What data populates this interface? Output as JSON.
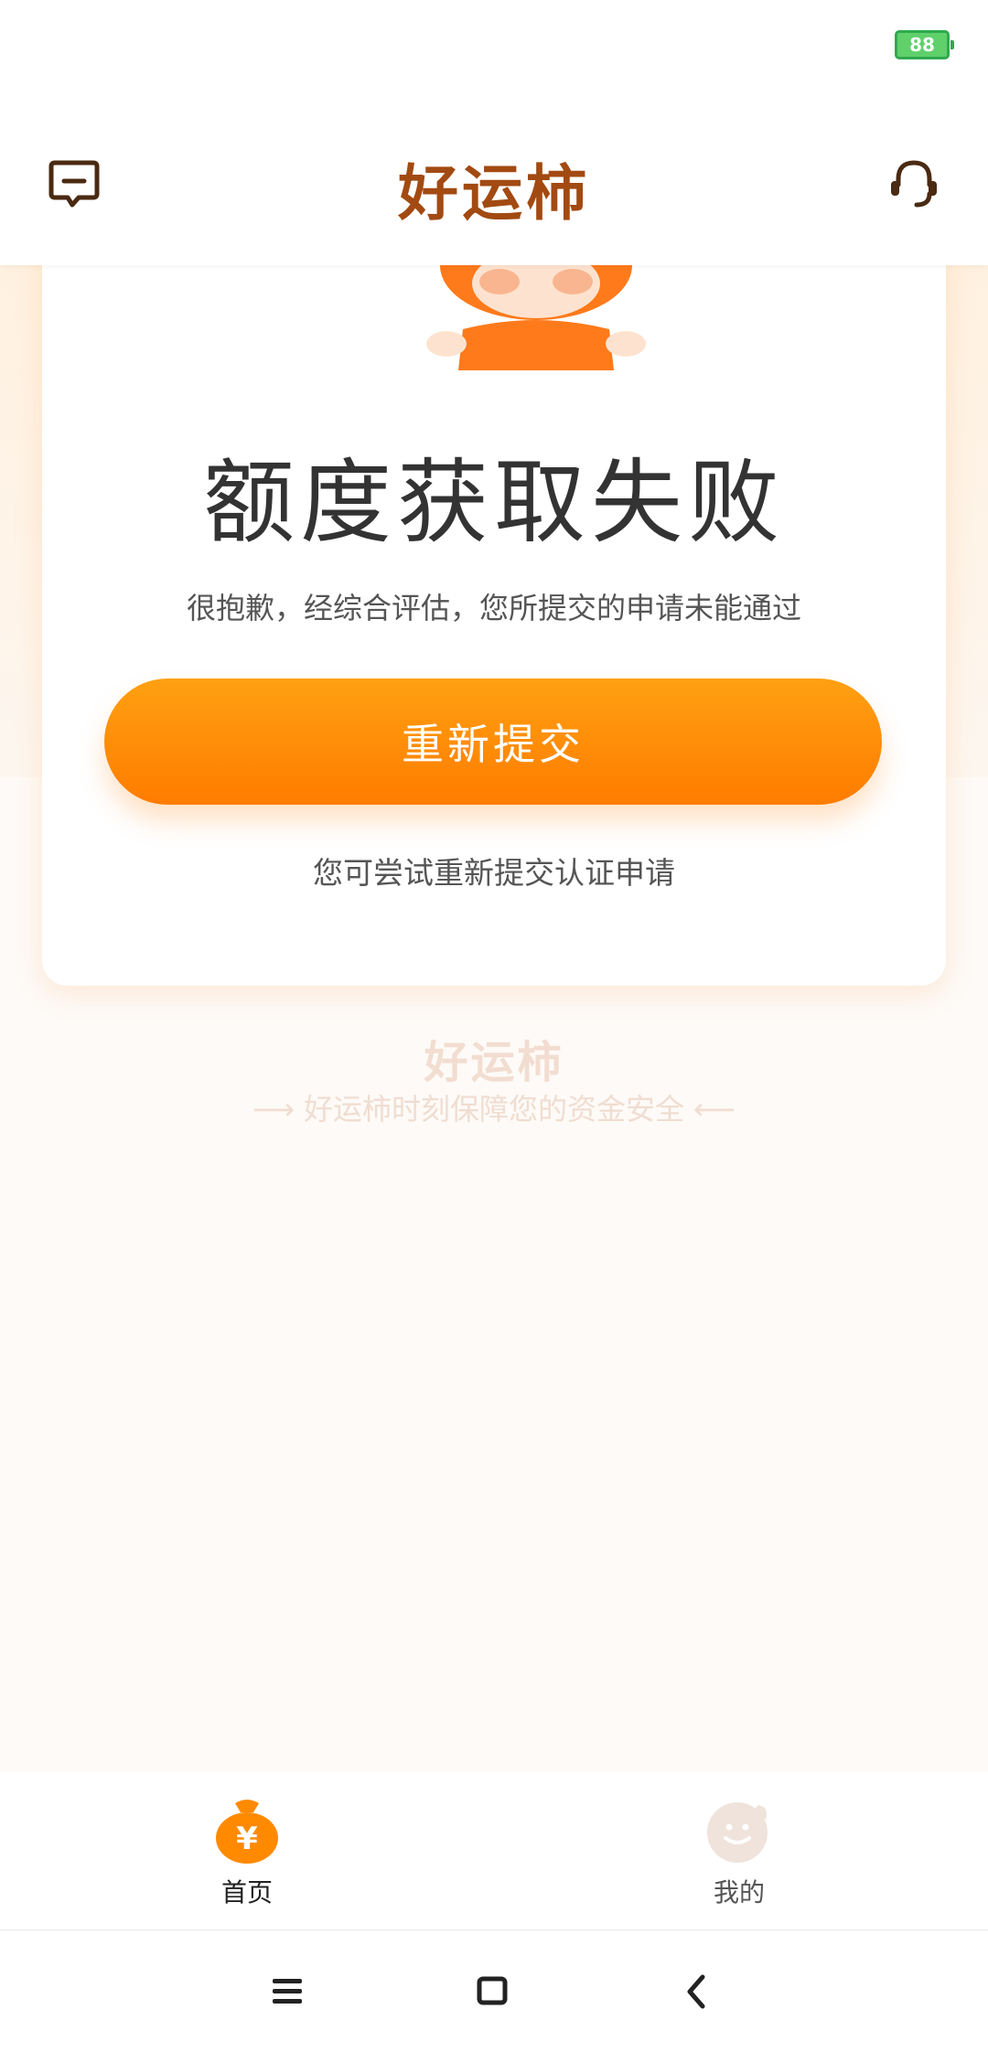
{
  "status_bar": {
    "battery_level": "88"
  },
  "header": {
    "title": "好运柿",
    "left_icon": "message-icon",
    "right_icon": "headset-icon"
  },
  "result": {
    "title": "额度获取失败",
    "subtitle": "很抱歉，经综合评估，您所提交的申请未能通过",
    "button_label": "重新提交",
    "hint": "您可尝试重新提交认证申请"
  },
  "footer": {
    "brand": "好运柿",
    "slogan": "好运柿时刻保障您的资金安全"
  },
  "tabs": [
    {
      "label": "首页",
      "icon": "money-bag-icon",
      "active": true
    },
    {
      "label": "我的",
      "icon": "smiley-icon",
      "active": false
    }
  ],
  "system_nav": {
    "icons": [
      "menu-icon",
      "home-square-icon",
      "back-icon"
    ]
  },
  "colors": {
    "accent": "#ff8a00",
    "brand_title": "#a24a12",
    "page_bg": "#fdfaf7"
  }
}
